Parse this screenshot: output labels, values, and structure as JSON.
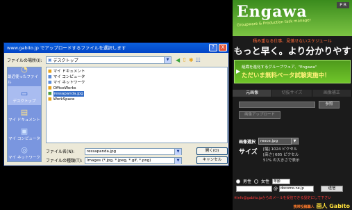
{
  "dialog": {
    "title": "www.gabito.jp でアップロードするファイルを選択します",
    "help_btn": "?",
    "close_btn": "X",
    "lookin_label": "ファイルの場所(I):",
    "lookin_value": "デスクトップ",
    "places": [
      {
        "label": "最近使ったファイル",
        "icon": "recent-icon"
      },
      {
        "label": "デスクトップ",
        "icon": "desktop-icon"
      },
      {
        "label": "マイ ドキュメント",
        "icon": "my-documents-icon"
      },
      {
        "label": "マイ コンピュータ",
        "icon": "my-computer-icon"
      },
      {
        "label": "マイ ネットワーク",
        "icon": "my-network-icon"
      }
    ],
    "files": [
      {
        "name": "マイ ドキュメント"
      },
      {
        "name": "マイ コンピュータ"
      },
      {
        "name": "マイ ネットワーク"
      },
      {
        "name": "OfficeWorks"
      },
      {
        "name": "ressapanda.jpg"
      },
      {
        "name": "WorkSpace"
      }
    ],
    "filename_label": "ファイル名(N):",
    "filename_value": "ressapanda.jpg",
    "filetype_label": "ファイルの種類(T):",
    "filetype_value": "Images (*.jpg, *.jpeg, *.gif, *.png)",
    "open_btn": "開く(O)",
    "cancel_btn": "キャンセル"
  },
  "panel": {
    "logo": "Engawa",
    "logo_sub": "Groupware & Production task manager",
    "pr": "P R",
    "tagline_top": "積み重なる仕事、見落せないスケジュール",
    "tagline_main": "もっと早く。より分かりやすく。",
    "promo_a": "組織を進化するグループウェア、\"Engawa\"",
    "promo_b": "ただいま無料ベータ試験実施中！",
    "tabs": [
      "元画像",
      "切抜サイズ",
      "画像補正"
    ],
    "ref_btn": "参照",
    "upload_btn": "画像アップロード",
    "sel_label": "画像選択",
    "sel_value": "resce.jpg",
    "size_label": "サイズ",
    "size_lines": [
      "[幅] 1024 ピクセル",
      "[高さ] 685 ピクセル",
      "51% の大きさで表示"
    ],
    "male": "男性",
    "female": "女性",
    "age_value": "年齢",
    "domain_value": "docomo.ne.jp",
    "send_btn": "送信",
    "notice": "※info@gabito.jpからのメールを受信できる設定にして下さい",
    "company_small": "携帯投稿職人",
    "company": "画人 Gabito"
  }
}
